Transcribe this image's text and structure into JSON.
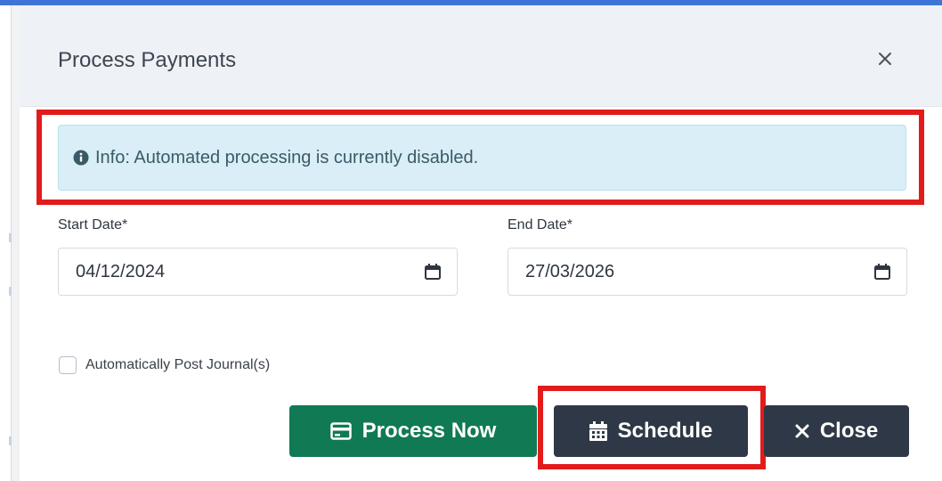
{
  "modal": {
    "title": "Process Payments",
    "close_icon": "close-icon"
  },
  "info_alert": {
    "icon": "info-circle-icon",
    "text": "Info: Automated processing is currently disabled."
  },
  "start_date": {
    "label": "Start Date*",
    "value": "04/12/2024",
    "icon": "calendar-icon"
  },
  "end_date": {
    "label": "End Date*",
    "value": "27/03/2026",
    "icon": "calendar-icon"
  },
  "auto_post": {
    "label": "Automatically Post Journal(s)",
    "checked": false
  },
  "buttons": {
    "process_now": {
      "label": "Process Now",
      "icon": "credit-card-icon",
      "color": "#107a55"
    },
    "schedule": {
      "label": "Schedule",
      "icon": "calendar-icon",
      "color": "#2f3846"
    },
    "close": {
      "label": "Close",
      "icon": "x-icon",
      "color": "#2f3846"
    }
  },
  "colors": {
    "highlight": "#e21b1b",
    "top_accent": "#3f73d8",
    "info_bg": "#d9eef6"
  }
}
